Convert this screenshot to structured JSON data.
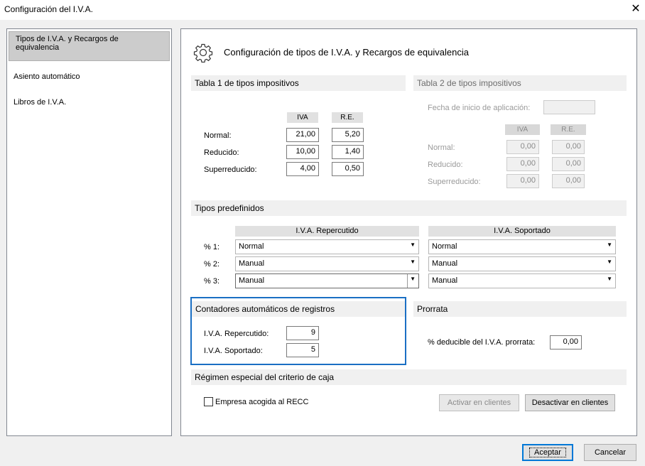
{
  "window": {
    "title": "Configuración del I.V.A.",
    "close_icon": "close-icon"
  },
  "sidebar": {
    "items": [
      {
        "label": "Tipos de I.V.A. y Recargos de equivalencia",
        "selected": true
      },
      {
        "label": "Asiento automático"
      },
      {
        "label": "Libros de I.V.A."
      }
    ]
  },
  "main": {
    "title": "Configuración de tipos de I.V.A. y Recargos de equivalencia",
    "icon": "gear-icon",
    "tabla1": {
      "title": "Tabla 1 de tipos impositivos",
      "col_iva": "IVA",
      "col_re": "R.E.",
      "rows": [
        {
          "label": "Normal:",
          "iva": "21,00",
          "re": "5,20"
        },
        {
          "label": "Reducido:",
          "iva": "10,00",
          "re": "1,40"
        },
        {
          "label": "Superreducido:",
          "iva": "4,00",
          "re": "0,50"
        }
      ]
    },
    "tabla2": {
      "title": "Tabla 2 de tipos impositivos",
      "fecha_label": "Fecha de inicio de aplicación:",
      "fecha_value": "",
      "col_iva": "IVA",
      "col_re": "R.E.",
      "rows": [
        {
          "label": "Normal:",
          "iva": "0,00",
          "re": "0,00"
        },
        {
          "label": "Reducido:",
          "iva": "0,00",
          "re": "0,00"
        },
        {
          "label": "Superreducido:",
          "iva": "0,00",
          "re": "0,00"
        }
      ]
    },
    "predefinidos": {
      "title": "Tipos predefinidos",
      "col_repercutido": "I.V.A. Repercutido",
      "col_soportado": "I.V.A. Soportado",
      "rows": [
        {
          "label": "% 1:",
          "repercutido": "Normal",
          "soportado": "Normal"
        },
        {
          "label": "% 2:",
          "repercutido": "Manual",
          "soportado": "Manual"
        },
        {
          "label": "% 3:",
          "repercutido": "Manual",
          "soportado": "Manual"
        }
      ]
    },
    "contadores": {
      "title": "Contadores automáticos de registros",
      "repercutido_label": "I.V.A. Repercutido:",
      "repercutido_value": "9",
      "soportado_label": "I.V.A. Soportado:",
      "soportado_value": "5"
    },
    "prorrata": {
      "title": "Prorrata",
      "label": "% deducible del I.V.A. prorrata:",
      "value": "0,00"
    },
    "regimen": {
      "title": "Régimen especial del criterio de caja",
      "checkbox_label": "Empresa acogida al RECC",
      "checked": false,
      "activar_label": "Activar en clientes",
      "desactivar_label": "Desactivar en clientes"
    }
  },
  "footer": {
    "accept_label": "Aceptar",
    "cancel_label": "Cancelar"
  }
}
